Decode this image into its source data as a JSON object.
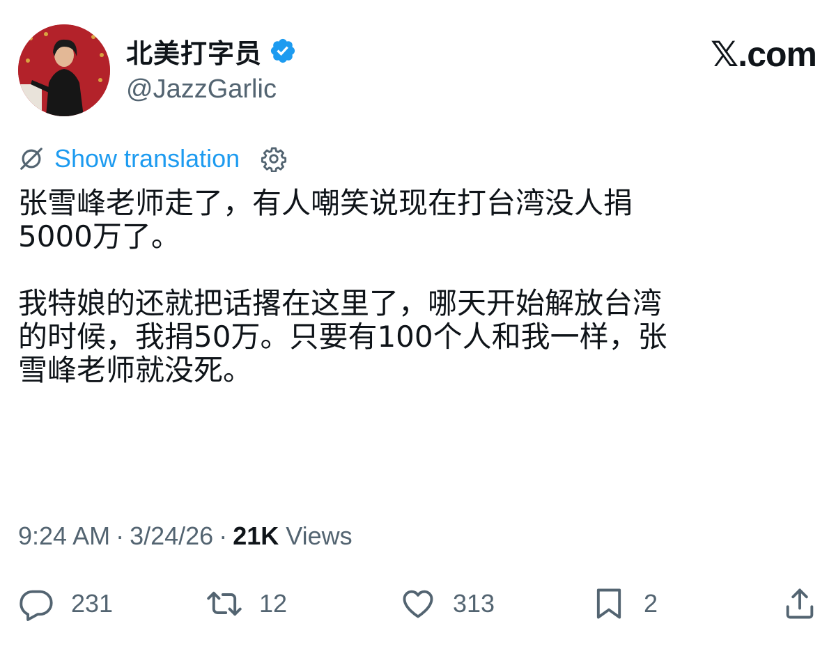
{
  "author": {
    "display_name": "北美打字员",
    "handle": "@JazzGarlic",
    "verified": true
  },
  "site_logo": {
    "mark": "𝕏",
    "text": ".com"
  },
  "translation": {
    "link_text": "Show translation"
  },
  "tweet": {
    "paragraphs": [
      "张雪峰老师走了，有人嘲笑说现在打台湾没人捐\n5000万了。",
      "我特娘的还就把话撂在这里了，哪天开始解放台湾\n的时候，我捐50万。只要有100个人和我一样，张\n雪峰老师就没死。"
    ]
  },
  "meta": {
    "time": "9:24 AM",
    "separator": "·",
    "date": "3/24/26",
    "views_count": "21K",
    "views_label": "Views"
  },
  "actions": {
    "replies": "231",
    "reposts": "12",
    "likes": "313",
    "bookmarks": "2"
  },
  "colors": {
    "link_blue": "#1d9bf0",
    "text_primary": "#0f1419",
    "text_secondary": "#536471",
    "avatar_background": "#b3222a"
  }
}
